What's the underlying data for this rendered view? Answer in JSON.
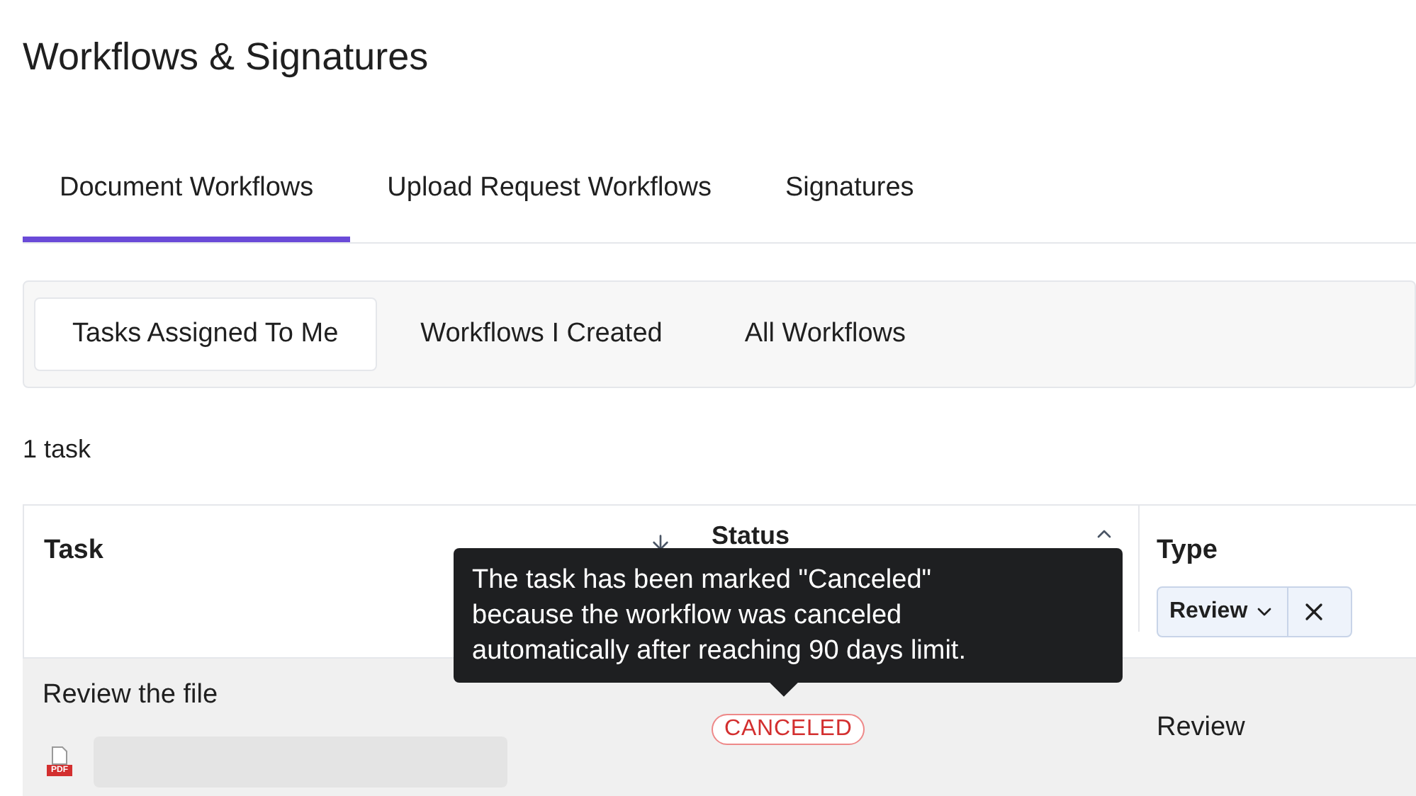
{
  "title": "Workflows & Signatures",
  "tabs": [
    {
      "label": "Document Workflows",
      "selected": true
    },
    {
      "label": "Upload Request Workflows",
      "selected": false
    },
    {
      "label": "Signatures",
      "selected": false
    }
  ],
  "subtabs": [
    {
      "label": "Tasks Assigned To Me",
      "selected": true
    },
    {
      "label": "Workflows I Created",
      "selected": false
    },
    {
      "label": "All Workflows",
      "selected": false
    }
  ],
  "count": "1 task",
  "table": {
    "columns": [
      {
        "label": "Task",
        "kind": "sort-down"
      },
      {
        "label": "Status",
        "kind": "sort-up"
      },
      {
        "label": "Type",
        "kind": "filter",
        "filter": "Review"
      }
    ],
    "rows": [
      {
        "task": "Review the file",
        "file_type": "PDF",
        "status": "CANCELED",
        "type": "Review"
      }
    ]
  },
  "tooltip": "The task has been marked \"Canceled\" because the workflow was canceled automatically after reaching 90 days limit."
}
